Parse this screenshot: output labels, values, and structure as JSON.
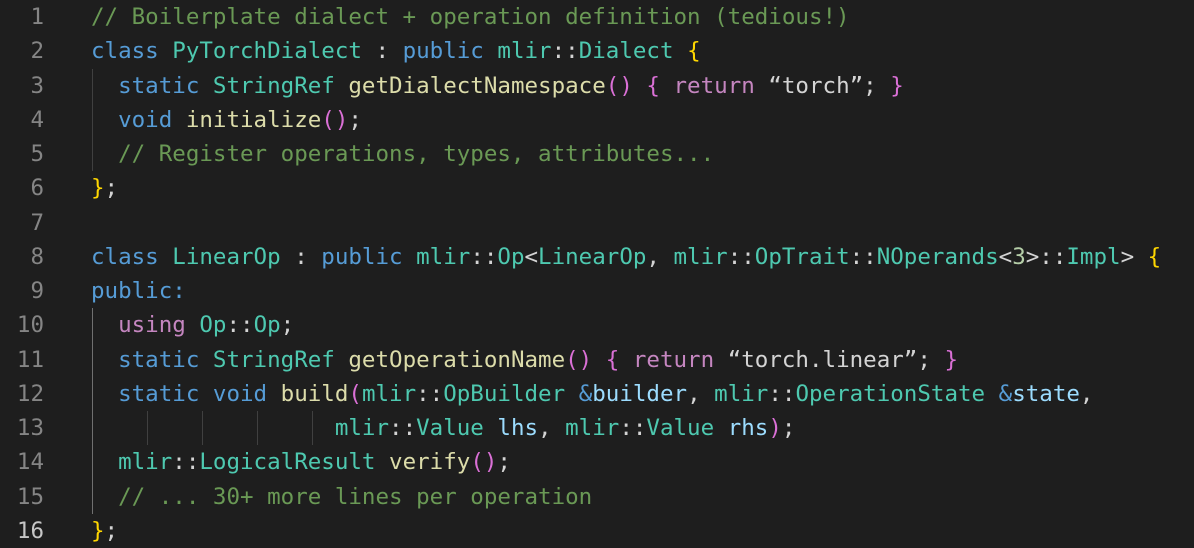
{
  "editor": {
    "colors": {
      "background": "#1e1e1e",
      "line_number": "#858585",
      "line_number_active": "#c6c6c6",
      "comment": "#6a9955",
      "keyword": "#569cd6",
      "control": "#c586c0",
      "type": "#4ec9b0",
      "function": "#dcdcaa",
      "variable": "#9cdcfe",
      "string": "#ce9178",
      "number": "#b5cea8",
      "brace_level1": "#ffd700",
      "brace_level2": "#da70d6",
      "brace_level3": "#179fff"
    },
    "active_line": 16,
    "lines": [
      {
        "num": "1",
        "tokens": [
          {
            "t": "// Boilerplate dialect + operation definition (tedious!)",
            "c": "comment"
          }
        ]
      },
      {
        "num": "2",
        "tokens": [
          {
            "t": "class",
            "c": "keyword"
          },
          {
            "t": " ",
            "c": "plain"
          },
          {
            "t": "PyTorchDialect",
            "c": "type"
          },
          {
            "t": " : ",
            "c": "plain"
          },
          {
            "t": "public",
            "c": "keyword"
          },
          {
            "t": " ",
            "c": "plain"
          },
          {
            "t": "mlir",
            "c": "type"
          },
          {
            "t": "::",
            "c": "plain"
          },
          {
            "t": "Dialect",
            "c": "type"
          },
          {
            "t": " ",
            "c": "plain"
          },
          {
            "t": "{",
            "c": "brace1"
          }
        ]
      },
      {
        "num": "3",
        "tokens": [
          {
            "t": "  ",
            "c": "plain"
          },
          {
            "t": "static",
            "c": "keyword"
          },
          {
            "t": " ",
            "c": "plain"
          },
          {
            "t": "StringRef",
            "c": "type"
          },
          {
            "t": " ",
            "c": "plain"
          },
          {
            "t": "getDialectNamespace",
            "c": "func"
          },
          {
            "t": "()",
            "c": "brace2"
          },
          {
            "t": " ",
            "c": "plain"
          },
          {
            "t": "{",
            "c": "brace2"
          },
          {
            "t": " ",
            "c": "plain"
          },
          {
            "t": "return",
            "c": "control"
          },
          {
            "t": " ",
            "c": "plain"
          },
          {
            "t": "“torch”",
            "c": "plain"
          },
          {
            "t": "; ",
            "c": "plain"
          },
          {
            "t": "}",
            "c": "brace2"
          }
        ]
      },
      {
        "num": "4",
        "tokens": [
          {
            "t": "  ",
            "c": "plain"
          },
          {
            "t": "void",
            "c": "keyword"
          },
          {
            "t": " ",
            "c": "plain"
          },
          {
            "t": "initialize",
            "c": "func"
          },
          {
            "t": "()",
            "c": "brace2"
          },
          {
            "t": ";",
            "c": "plain"
          }
        ]
      },
      {
        "num": "5",
        "tokens": [
          {
            "t": "  ",
            "c": "plain"
          },
          {
            "t": "// Register operations, types, attributes...",
            "c": "comment"
          }
        ]
      },
      {
        "num": "6",
        "tokens": [
          {
            "t": "}",
            "c": "brace1"
          },
          {
            "t": ";",
            "c": "plain"
          }
        ]
      },
      {
        "num": "7",
        "tokens": []
      },
      {
        "num": "8",
        "tokens": [
          {
            "t": "class",
            "c": "keyword"
          },
          {
            "t": " ",
            "c": "plain"
          },
          {
            "t": "LinearOp",
            "c": "type"
          },
          {
            "t": " : ",
            "c": "plain"
          },
          {
            "t": "public",
            "c": "keyword"
          },
          {
            "t": " ",
            "c": "plain"
          },
          {
            "t": "mlir",
            "c": "type"
          },
          {
            "t": "::",
            "c": "plain"
          },
          {
            "t": "Op",
            "c": "type"
          },
          {
            "t": "<",
            "c": "plain"
          },
          {
            "t": "LinearOp",
            "c": "type"
          },
          {
            "t": ", ",
            "c": "plain"
          },
          {
            "t": "mlir",
            "c": "type"
          },
          {
            "t": "::",
            "c": "plain"
          },
          {
            "t": "OpTrait",
            "c": "type"
          },
          {
            "t": "::",
            "c": "plain"
          },
          {
            "t": "NOperands",
            "c": "type"
          },
          {
            "t": "<",
            "c": "plain"
          },
          {
            "t": "3",
            "c": "number"
          },
          {
            "t": ">::",
            "c": "plain"
          },
          {
            "t": "Impl",
            "c": "type"
          },
          {
            "t": "> ",
            "c": "plain"
          },
          {
            "t": "{",
            "c": "brace1"
          }
        ]
      },
      {
        "num": "9",
        "tokens": [
          {
            "t": "public:",
            "c": "keyword"
          }
        ]
      },
      {
        "num": "10",
        "tokens": [
          {
            "t": "  ",
            "c": "plain"
          },
          {
            "t": "using",
            "c": "control"
          },
          {
            "t": " ",
            "c": "plain"
          },
          {
            "t": "Op",
            "c": "type"
          },
          {
            "t": "::",
            "c": "plain"
          },
          {
            "t": "Op",
            "c": "type"
          },
          {
            "t": ";",
            "c": "plain"
          }
        ]
      },
      {
        "num": "11",
        "tokens": [
          {
            "t": "  ",
            "c": "plain"
          },
          {
            "t": "static",
            "c": "keyword"
          },
          {
            "t": " ",
            "c": "plain"
          },
          {
            "t": "StringRef",
            "c": "type"
          },
          {
            "t": " ",
            "c": "plain"
          },
          {
            "t": "getOperationName",
            "c": "func"
          },
          {
            "t": "()",
            "c": "brace2"
          },
          {
            "t": " ",
            "c": "plain"
          },
          {
            "t": "{",
            "c": "brace2"
          },
          {
            "t": " ",
            "c": "plain"
          },
          {
            "t": "return",
            "c": "control"
          },
          {
            "t": " ",
            "c": "plain"
          },
          {
            "t": "“torch.linear”",
            "c": "plain"
          },
          {
            "t": "; ",
            "c": "plain"
          },
          {
            "t": "}",
            "c": "brace2"
          }
        ]
      },
      {
        "num": "12",
        "tokens": [
          {
            "t": "  ",
            "c": "plain"
          },
          {
            "t": "static",
            "c": "keyword"
          },
          {
            "t": " ",
            "c": "plain"
          },
          {
            "t": "void",
            "c": "keyword"
          },
          {
            "t": " ",
            "c": "plain"
          },
          {
            "t": "build",
            "c": "func"
          },
          {
            "t": "(",
            "c": "brace2"
          },
          {
            "t": "mlir",
            "c": "type"
          },
          {
            "t": "::",
            "c": "plain"
          },
          {
            "t": "OpBuilder",
            "c": "type"
          },
          {
            "t": " ",
            "c": "plain"
          },
          {
            "t": "&",
            "c": "keyword"
          },
          {
            "t": "builder",
            "c": "var"
          },
          {
            "t": ", ",
            "c": "plain"
          },
          {
            "t": "mlir",
            "c": "type"
          },
          {
            "t": "::",
            "c": "plain"
          },
          {
            "t": "OperationState",
            "c": "type"
          },
          {
            "t": " ",
            "c": "plain"
          },
          {
            "t": "&",
            "c": "keyword"
          },
          {
            "t": "state",
            "c": "var"
          },
          {
            "t": ",",
            "c": "plain"
          }
        ]
      },
      {
        "num": "13",
        "tokens": [
          {
            "t": "                  ",
            "c": "plain"
          },
          {
            "t": "mlir",
            "c": "type"
          },
          {
            "t": "::",
            "c": "plain"
          },
          {
            "t": "Value",
            "c": "type"
          },
          {
            "t": " ",
            "c": "plain"
          },
          {
            "t": "lhs",
            "c": "var"
          },
          {
            "t": ", ",
            "c": "plain"
          },
          {
            "t": "mlir",
            "c": "type"
          },
          {
            "t": "::",
            "c": "plain"
          },
          {
            "t": "Value",
            "c": "type"
          },
          {
            "t": " ",
            "c": "plain"
          },
          {
            "t": "rhs",
            "c": "var"
          },
          {
            "t": ")",
            "c": "brace2"
          },
          {
            "t": ";",
            "c": "plain"
          }
        ]
      },
      {
        "num": "14",
        "tokens": [
          {
            "t": "  ",
            "c": "plain"
          },
          {
            "t": "mlir",
            "c": "type"
          },
          {
            "t": "::",
            "c": "plain"
          },
          {
            "t": "LogicalResult",
            "c": "type"
          },
          {
            "t": " ",
            "c": "plain"
          },
          {
            "t": "verify",
            "c": "func"
          },
          {
            "t": "()",
            "c": "brace2"
          },
          {
            "t": ";",
            "c": "plain"
          }
        ]
      },
      {
        "num": "15",
        "tokens": [
          {
            "t": "  ",
            "c": "plain"
          },
          {
            "t": "// ... 30+ more lines per operation",
            "c": "comment"
          }
        ]
      },
      {
        "num": "16",
        "tokens": [
          {
            "t": "}",
            "c": "brace1"
          },
          {
            "t": ";",
            "c": "plain"
          }
        ]
      }
    ]
  }
}
